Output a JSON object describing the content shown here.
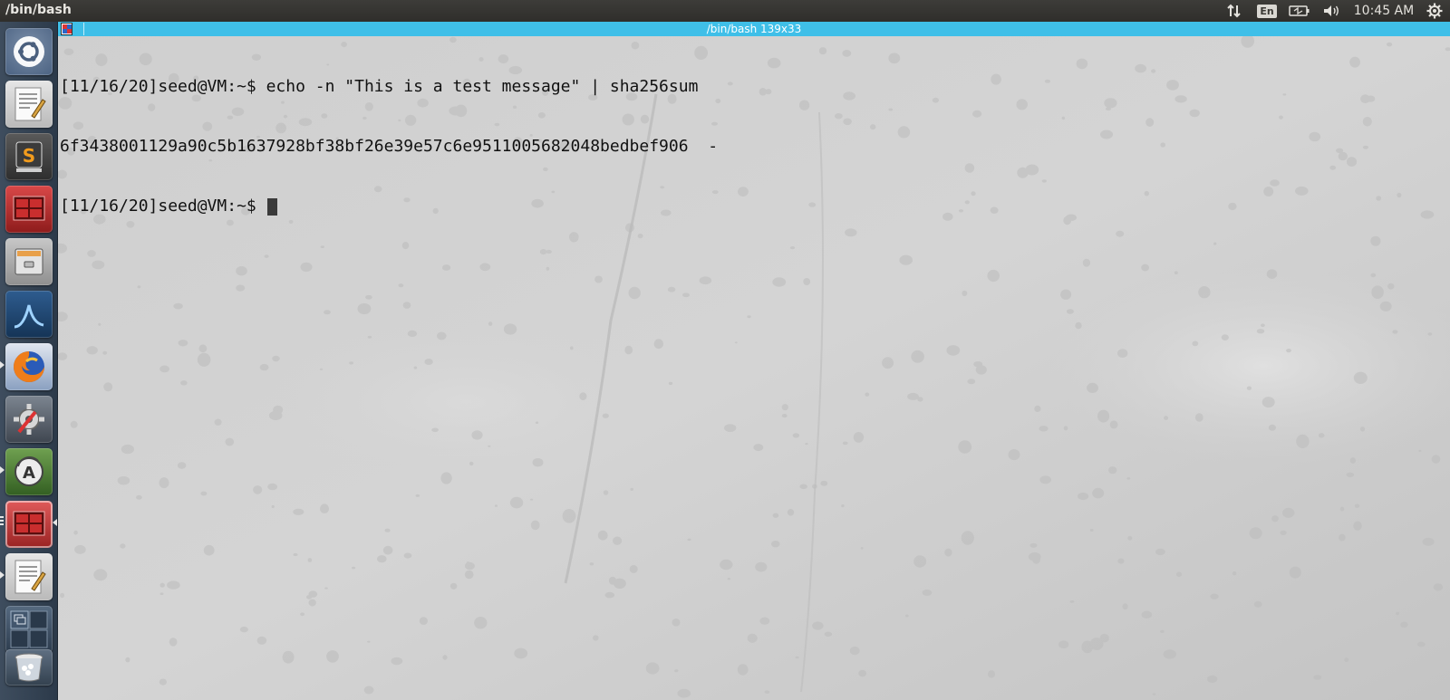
{
  "top_panel": {
    "title": "/bin/bash",
    "lang": "En",
    "clock": "10:45 AM",
    "icons": [
      "network-icon",
      "keyboard-lang-icon",
      "battery-icon",
      "volume-icon",
      "settings-gear-icon"
    ]
  },
  "launcher": {
    "items": [
      {
        "name": "ubuntu-dash-icon"
      },
      {
        "name": "text-editor-icon"
      },
      {
        "name": "sublime-text-icon"
      },
      {
        "name": "terminal-icon"
      },
      {
        "name": "files-icon"
      },
      {
        "name": "wireshark-icon"
      },
      {
        "name": "firefox-icon"
      },
      {
        "name": "system-settings-icon"
      },
      {
        "name": "software-updater-icon"
      },
      {
        "name": "terminal-active-icon"
      },
      {
        "name": "text-editor-2-icon"
      },
      {
        "name": "workspace-switcher-icon"
      },
      {
        "name": "trash-icon"
      }
    ]
  },
  "terminal": {
    "title": "/bin/bash 139x33",
    "lines": [
      "[11/16/20]seed@VM:~$ echo -n \"This is a test message\" | sha256sum",
      "6f3438001129a90c5b1637928bf38bf26e39e57c6e9511005682048bedbef906  -"
    ],
    "prompt": "[11/16/20]seed@VM:~$ "
  },
  "colors": {
    "titlebar": "#3fbfe8",
    "panel": "#33322f",
    "launcher": "#35444f"
  }
}
